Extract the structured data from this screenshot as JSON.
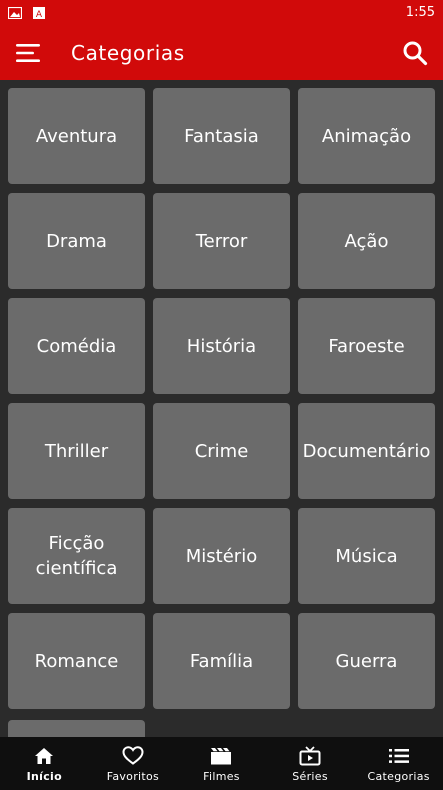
{
  "status_bar": {
    "time": "1:55",
    "icons": [
      "image-icon",
      "text-a-icon"
    ]
  },
  "app_bar": {
    "title": "Categorias",
    "menu_icon": "menu-icon",
    "search_icon": "search-icon",
    "color": "#d10a0a"
  },
  "categories": [
    "Aventura",
    "Fantasia",
    "Animação",
    "Drama",
    "Terror",
    "Ação",
    "Comédia",
    "História",
    "Faroeste",
    "Thriller",
    "Crime",
    "Documentário",
    "Ficção científica",
    "Mistério",
    "Música",
    "Romance",
    "Família",
    "Guerra"
  ],
  "bottom_nav": [
    {
      "label": "Início",
      "icon": "home-icon",
      "active": true
    },
    {
      "label": "Favoritos",
      "icon": "heart-icon",
      "active": false
    },
    {
      "label": "Filmes",
      "icon": "clapperboard-icon",
      "active": false
    },
    {
      "label": "Séries",
      "icon": "tv-icon",
      "active": false
    },
    {
      "label": "Categorias",
      "icon": "list-icon",
      "active": false
    }
  ]
}
